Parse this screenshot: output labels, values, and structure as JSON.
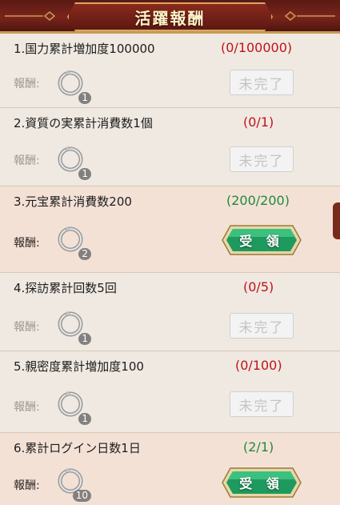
{
  "header": {
    "title": "活躍報酬"
  },
  "reward_label": "報酬:",
  "tasks": [
    {
      "label": "1.国力累計増加度100000",
      "progress": "(0/100000)",
      "status": "incomplete",
      "item_count": "1",
      "button": "未完了"
    },
    {
      "label": "2.資質の実累計消費数1個",
      "progress": "(0/1)",
      "status": "incomplete",
      "item_count": "1",
      "button": "未完了"
    },
    {
      "label": "3.元宝累計消費数200",
      "progress": "(200/200)",
      "status": "claimable",
      "item_count": "2",
      "button": "受 領"
    },
    {
      "label": "4.探訪累計回数5回",
      "progress": "(0/5)",
      "status": "incomplete",
      "item_count": "1",
      "button": "未完了"
    },
    {
      "label": "5.親密度累計増加度100",
      "progress": "(0/100)",
      "status": "incomplete",
      "item_count": "1",
      "button": "未完了"
    },
    {
      "label": "6.累計ログイン日数1日",
      "progress": "(2/1)",
      "status": "claimable",
      "item_count": "10",
      "button": "受 領"
    }
  ],
  "colors": {
    "progress_incomplete": "#c0121a",
    "progress_complete": "#1e8a3a",
    "claim_button": "#1f9a5e",
    "header": "#7a241a"
  }
}
